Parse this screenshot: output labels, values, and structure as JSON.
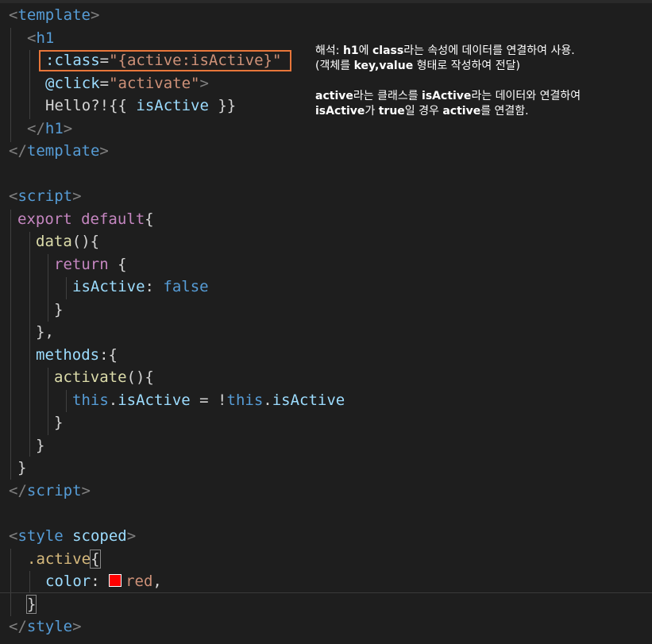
{
  "colors": {
    "background": "#1e1e1e",
    "tag": "#569cd6",
    "attribute": "#9cdcfe",
    "string": "#ce9178",
    "keyword": "#c586c0",
    "function": "#dcdcaa",
    "selector": "#d7ba7d",
    "highlight_box": "#e8763a",
    "swatch": "#ff0000"
  },
  "code": {
    "template_open": "template",
    "h1_open": "h1",
    "class_attr": ":class",
    "class_value": "\"{active:isActive}\"",
    "click_attr": "@click",
    "click_value": "\"activate\"",
    "h1_text_plain": "Hello?!{{ ",
    "h1_text_var": "isActive",
    "h1_text_end": " }}",
    "h1_close": "h1",
    "template_close": "template",
    "script_open": "script",
    "export_kw": "export",
    "default_kw": "default",
    "data_fn": "data",
    "return_kw": "return",
    "is_active_key": "isActive",
    "false_val": "false",
    "methods_key": "methods",
    "activate_fn": "activate",
    "this_kw": "this",
    "is_active_prop": "isActive",
    "script_close": "script",
    "style_open": "style",
    "scoped_attr": "scoped",
    "active_selector": ".active",
    "color_prop": "color",
    "red_value": "red",
    "style_close": "style"
  },
  "annotation": {
    "line1_prefix": "해석: ",
    "line1_b1": "h1",
    "line1_mid": "에 ",
    "line1_b2": "class",
    "line1_suffix": "라는 속성에 데이터를 연결하여 사용.",
    "line2_prefix": "(객체를 ",
    "line2_b1": "key,value",
    "line2_suffix": " 형태로 작성하여 전달)",
    "line3_b1": "active",
    "line3_mid": "라는 클래스를 ",
    "line3_b2": "isActive",
    "line3_suffix": "라는 데이터와 연결하여",
    "line4_b1": "isActive",
    "line4_mid1": "가 ",
    "line4_b2": "true",
    "line4_mid2": "일 경우 ",
    "line4_b3": "active",
    "line4_suffix": "를 연결함."
  }
}
